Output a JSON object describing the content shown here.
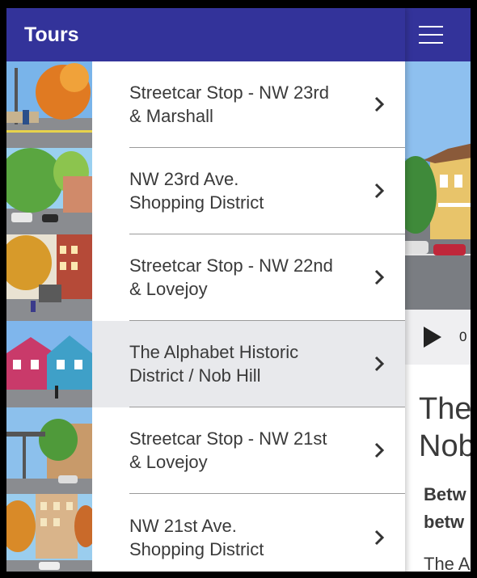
{
  "header": {
    "title": "Tours"
  },
  "tours": [
    {
      "title_line1": "Streetcar Stop - NW 23rd",
      "title_line2": "& Marshall"
    },
    {
      "title_line1": "NW 23rd Ave.",
      "title_line2": "Shopping District"
    },
    {
      "title_line1": "Streetcar Stop - NW 22nd",
      "title_line2": "& Lovejoy"
    },
    {
      "title_line1": "The Alphabet Historic",
      "title_line2": "District / Nob Hill"
    },
    {
      "title_line1": "Streetcar Stop - NW 21st",
      "title_line2": "& Lovejoy"
    },
    {
      "title_line1": "NW 21st Ave.",
      "title_line2": "Shopping District"
    }
  ],
  "detail": {
    "player_time": "0",
    "title_line1": "The",
    "title_line2": "Nob",
    "subtitle_line1": "Betw",
    "subtitle_line2": "betw",
    "body_text": "The A"
  },
  "colors": {
    "header": "#33339a",
    "active_row": "#e8e9ec",
    "text": "#3a3a3a"
  }
}
